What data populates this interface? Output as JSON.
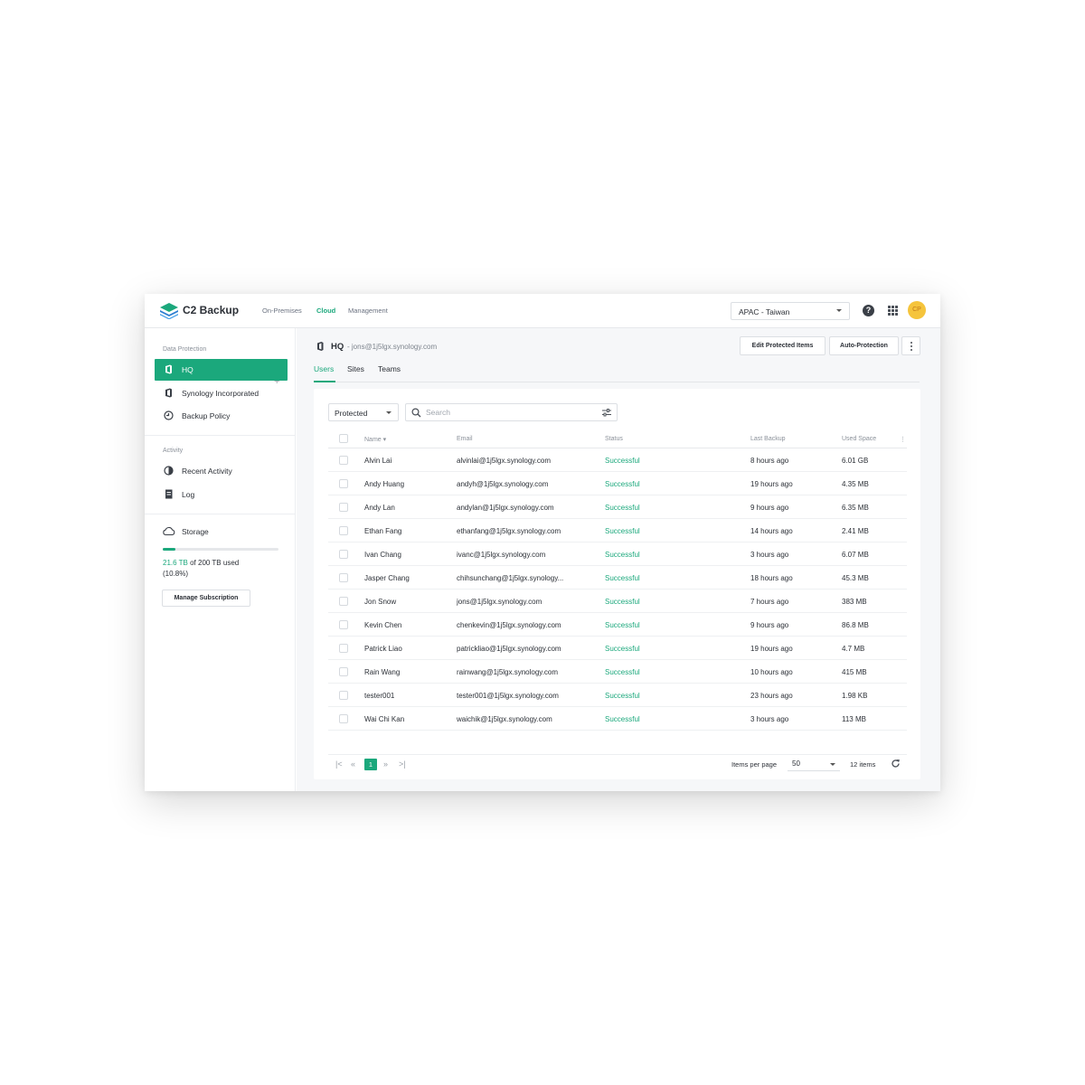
{
  "header": {
    "brand": "C2 Backup",
    "nav": [
      "On-Premises",
      "Cloud",
      "Management"
    ],
    "active_nav": "Cloud",
    "region": "APAC - Taiwan",
    "avatar_initials": "CP"
  },
  "sidebar": {
    "section_data_protection": "Data Protection",
    "items": [
      {
        "label": "HQ",
        "icon": "office-icon"
      },
      {
        "label": "Synology Incorporated",
        "icon": "office-icon"
      },
      {
        "label": "Backup Policy",
        "icon": "policy-icon"
      }
    ],
    "section_activity": "Activity",
    "activity_items": [
      {
        "label": "Recent Activity",
        "icon": "clock-icon"
      },
      {
        "label": "Log",
        "icon": "log-icon"
      }
    ],
    "storage": {
      "label": "Storage",
      "used": "21.6 TB",
      "used_suffix": " of 200 TB used",
      "percent": "(10.8%)",
      "fraction": 0.108,
      "manage_label": "Manage Subscription"
    }
  },
  "main": {
    "title": "HQ",
    "email": "- jons@1j5lgx.synology.com",
    "edit_button": "Edit Protected Items",
    "auto_button": "Auto-Protection",
    "tabs": [
      "Users",
      "Sites",
      "Teams"
    ],
    "filter": "Protected",
    "search_placeholder": "Search",
    "columns": [
      "Name",
      "Email",
      "Status",
      "Last Backup",
      "Used Space"
    ],
    "rows": [
      {
        "name": "Alvin Lai",
        "email": "alvinlai@1j5lgx.synology.com",
        "status": "Successful",
        "last": "8 hours ago",
        "used": "6.01 GB"
      },
      {
        "name": "Andy Huang",
        "email": "andyh@1j5lgx.synology.com",
        "status": "Successful",
        "last": "19 hours ago",
        "used": "4.35 MB"
      },
      {
        "name": "Andy Lan",
        "email": "andylan@1j5lgx.synology.com",
        "status": "Successful",
        "last": "9 hours ago",
        "used": "6.35 MB"
      },
      {
        "name": "Ethan Fang",
        "email": "ethanfang@1j5lgx.synology.com",
        "status": "Successful",
        "last": "14 hours ago",
        "used": "2.41 MB"
      },
      {
        "name": "Ivan Chang",
        "email": "ivanc@1j5lgx.synology.com",
        "status": "Successful",
        "last": "3 hours ago",
        "used": "6.07 MB"
      },
      {
        "name": "Jasper Chang",
        "email": "chihsunchang@1j5lgx.synology...",
        "status": "Successful",
        "last": "18 hours ago",
        "used": "45.3 MB"
      },
      {
        "name": "Jon Snow",
        "email": "jons@1j5lgx.synology.com",
        "status": "Successful",
        "last": "7 hours ago",
        "used": "383 MB"
      },
      {
        "name": "Kevin Chen",
        "email": "chenkevin@1j5lgx.synology.com",
        "status": "Successful",
        "last": "9 hours ago",
        "used": "86.8 MB"
      },
      {
        "name": "Patrick Liao",
        "email": "patrickliao@1j5lgx.synology.com",
        "status": "Successful",
        "last": "19 hours ago",
        "used": "4.7 MB"
      },
      {
        "name": "Rain Wang",
        "email": "rainwang@1j5lgx.synology.com",
        "status": "Successful",
        "last": "10 hours ago",
        "used": "415 MB"
      },
      {
        "name": "tester001",
        "email": "tester001@1j5lgx.synology.com",
        "status": "Successful",
        "last": "23 hours ago",
        "used": "1.98 KB"
      },
      {
        "name": "Wai Chi Kan",
        "email": "waichik@1j5lgx.synology.com",
        "status": "Successful",
        "last": "3 hours ago",
        "used": "113 MB"
      }
    ],
    "pager": {
      "current_page": "1",
      "items_per_page_label": "Items per page",
      "items_per_page": "50",
      "total": "12 items"
    }
  },
  "colors": {
    "accent": "#1ba87c",
    "avatar": "#f5c43c"
  }
}
